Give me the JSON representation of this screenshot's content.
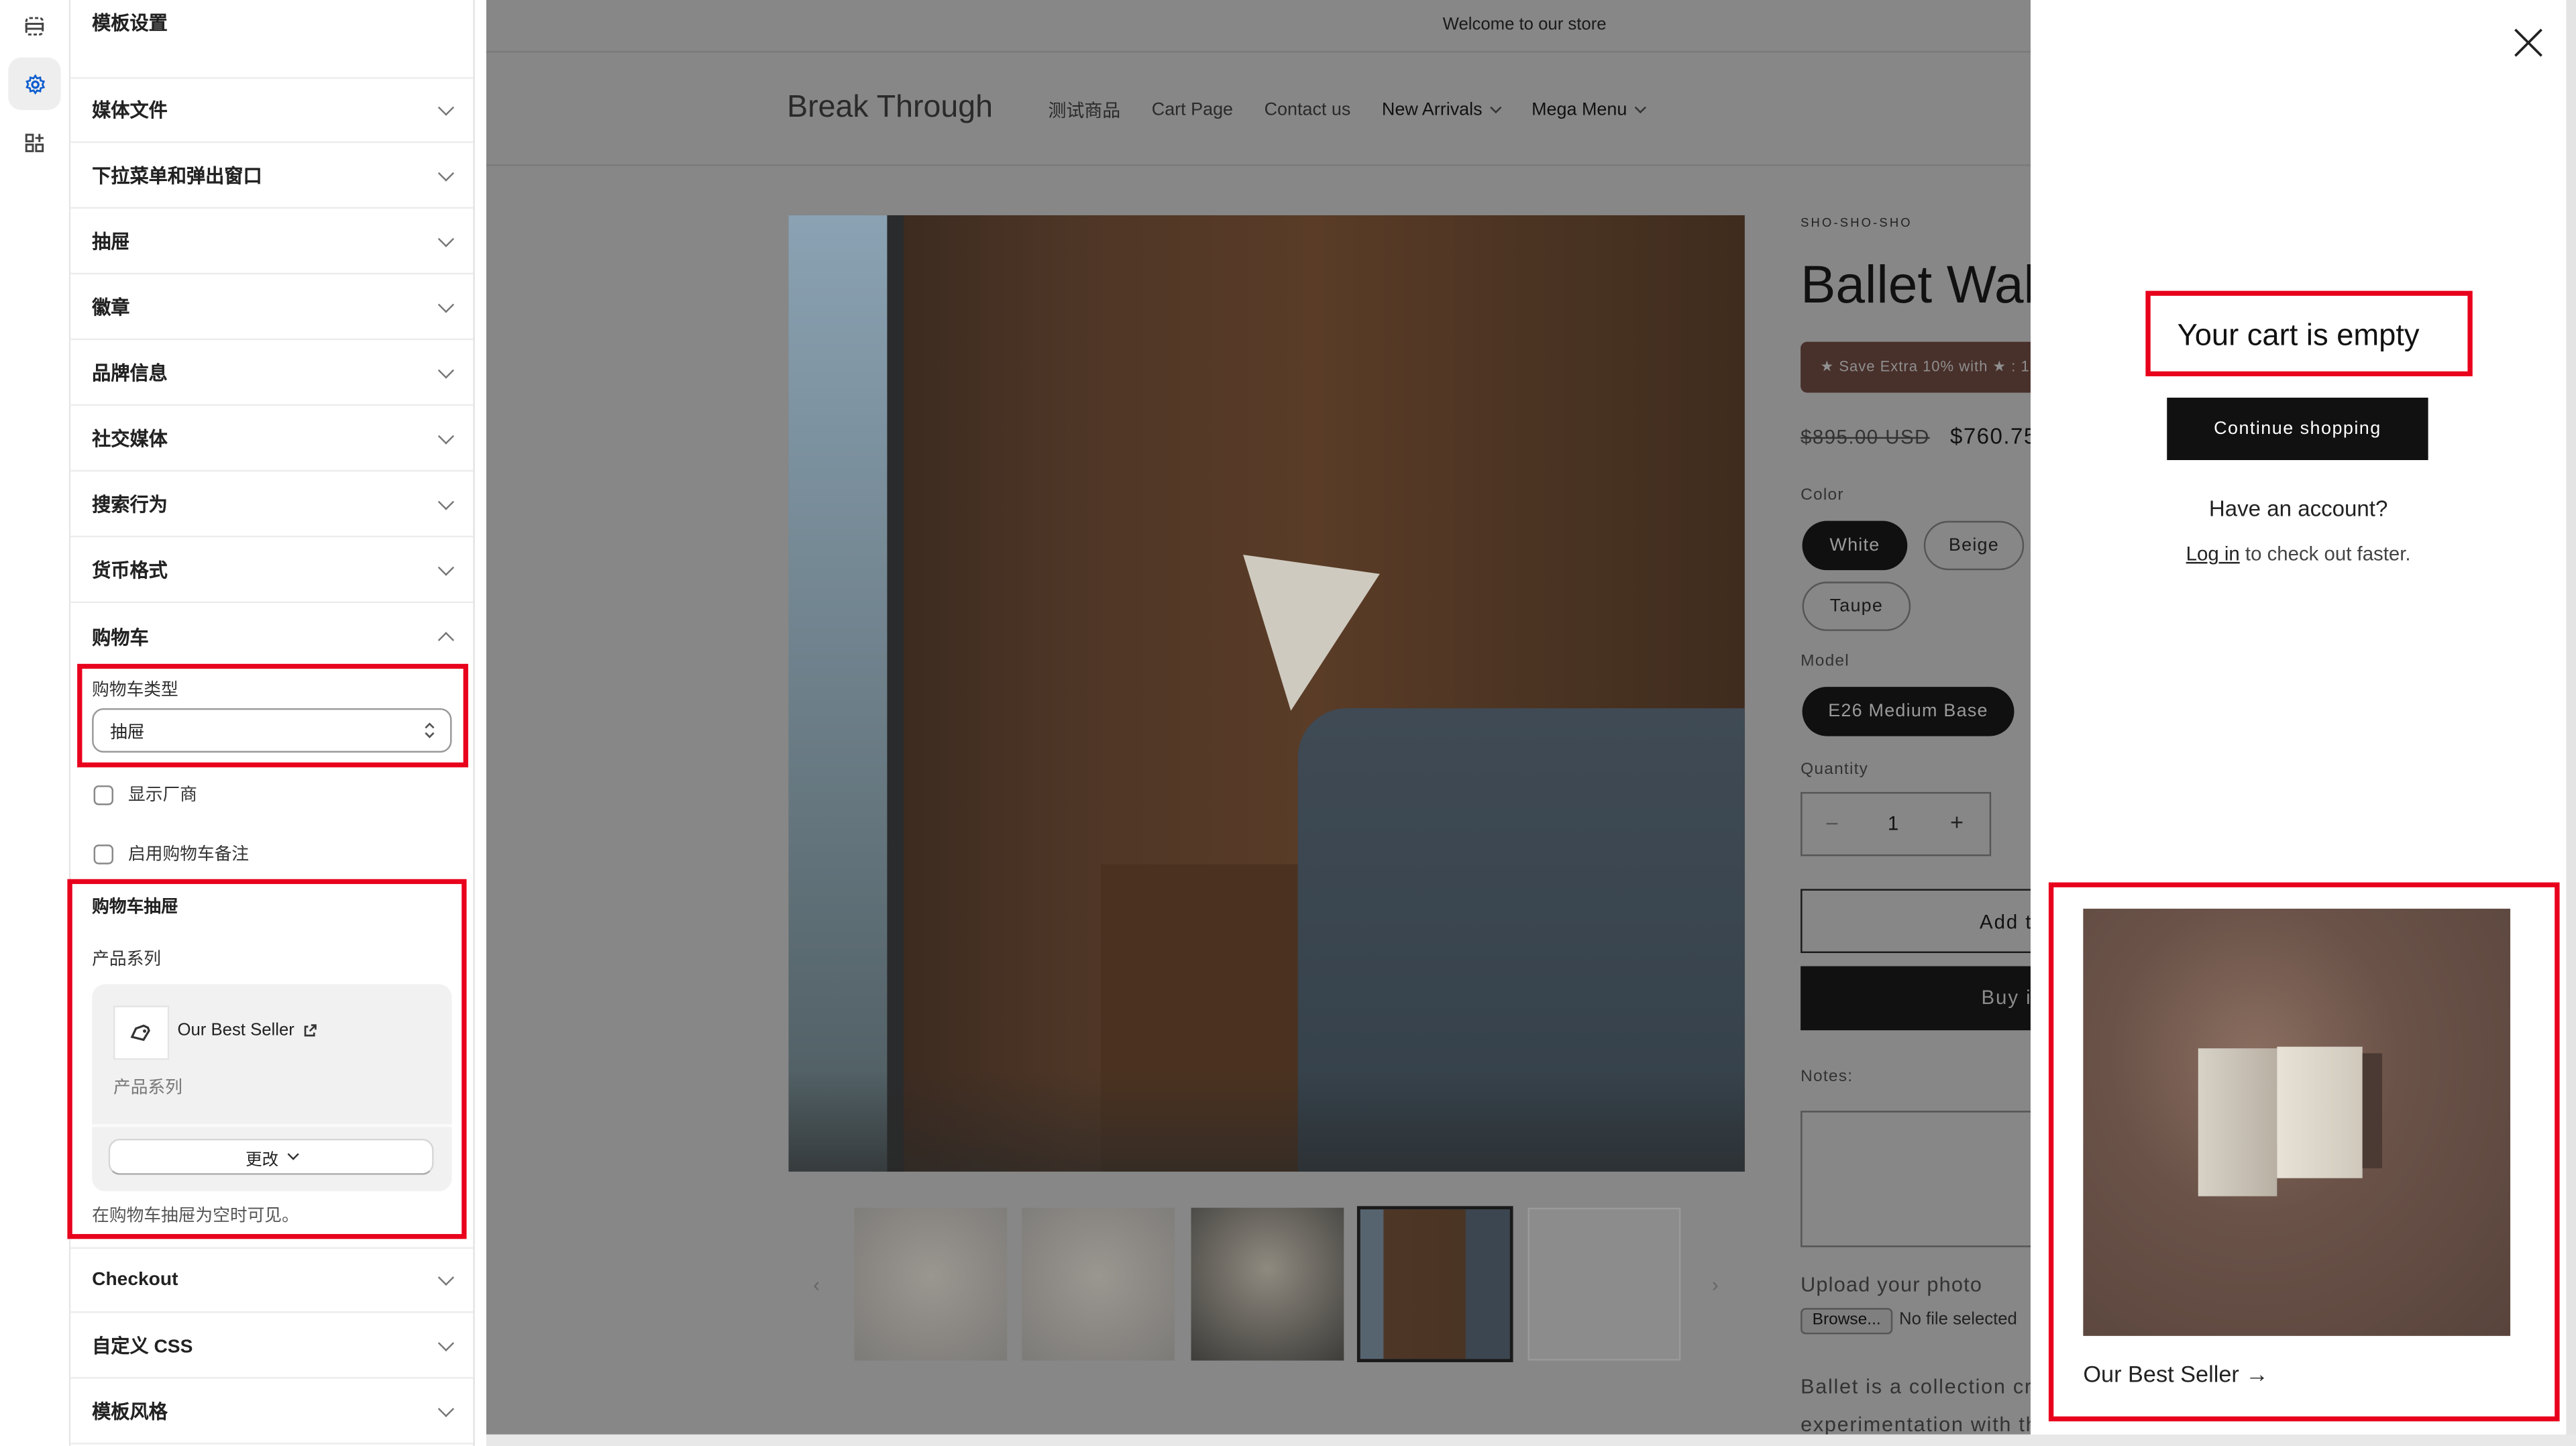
{
  "rail": {
    "icons": [
      "sections-icon",
      "gear-icon",
      "apps-icon"
    ],
    "accent": "#0b5ccf"
  },
  "sidebar": {
    "title": "模板设置",
    "items": [
      {
        "label": "媒体文件"
      },
      {
        "label": "下拉菜单和弹出窗口"
      },
      {
        "label": "抽屉"
      },
      {
        "label": "徽章"
      },
      {
        "label": "品牌信息"
      },
      {
        "label": "社交媒体"
      },
      {
        "label": "搜索行为"
      },
      {
        "label": "货币格式"
      }
    ],
    "cart": {
      "label": "购物车",
      "type_label": "购物车类型",
      "type_value": "抽屉",
      "show_vendor": "显示厂商",
      "enable_notes": "启用购物车备注",
      "drawer_heading": "购物车抽屉",
      "collection_label": "产品系列",
      "collection_name": "Our Best Seller",
      "collection_sub": "产品系列",
      "change_button": "更改",
      "help": "在购物车抽屉为空时可见。"
    },
    "items_after": [
      {
        "label": "Checkout"
      },
      {
        "label": "自定义 CSS"
      },
      {
        "label": "模板风格"
      }
    ]
  },
  "store": {
    "announcement": "Welcome to our store",
    "logo": "Break Through",
    "nav": [
      {
        "label": "测试商品"
      },
      {
        "label": "Cart Page"
      },
      {
        "label": "Contact us"
      },
      {
        "label": "New Arrivals"
      },
      {
        "label": "Mega Menu"
      }
    ],
    "product": {
      "vendor": "SHO-SHO-SHO",
      "title": "Ballet Wal",
      "badge": "★ Save Extra 10% with ★ : 1",
      "compare_price": "$895.00 USD",
      "price": "$760.75",
      "color_label": "Color",
      "colors": [
        "White",
        "Beige",
        "Taupe"
      ],
      "selected_color": "White",
      "model_label": "Model",
      "model": "E26 Medium Base",
      "quantity_label": "Quantity",
      "quantity": "1",
      "add_to_cart": "Add t",
      "buy_now": "Buy i",
      "notes_label": "Notes:",
      "upload_label": "Upload your photo",
      "browse": "Browse...",
      "no_file": "No file selected",
      "desc_1": "Ballet is a collection cre",
      "desc_2": "experimentation with th"
    }
  },
  "cart_drawer": {
    "empty": "Your cart is empty",
    "continue": "Continue shopping",
    "have_account": "Have an account?",
    "login": "Log in",
    "login_suffix": " to check out faster.",
    "collection": "Our Best Seller →"
  },
  "colors": {
    "highlight": "#e8001c",
    "overlay": "#878787",
    "badge": "#48302b"
  }
}
